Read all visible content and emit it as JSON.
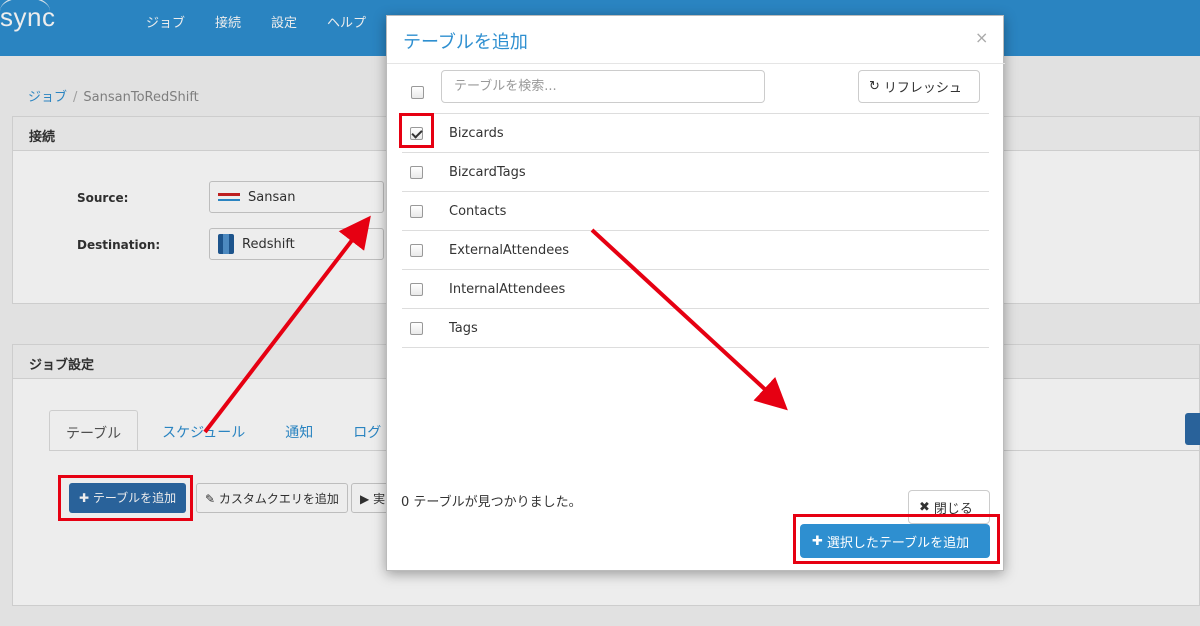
{
  "app": {
    "logo_text": "sync",
    "nav": [
      "ジョブ",
      "接続",
      "設定",
      "ヘルプ"
    ]
  },
  "breadcrumb": {
    "parent": "ジョブ",
    "separator": "/",
    "current": "SansanToRedShift"
  },
  "connection_panel": {
    "heading": "接続",
    "source_label": "Source:",
    "source_value": "Sansan",
    "destination_label": "Destination:",
    "destination_value": "Redshift"
  },
  "job_panel": {
    "heading": "ジョブ設定",
    "tabs": [
      "テーブル",
      "スケジュール",
      "通知",
      "ログ"
    ],
    "add_table_button": "テーブルを追加",
    "custom_query_button": "カスタムクエリを追加",
    "run_button": "実"
  },
  "modal": {
    "title": "テーブルを追加",
    "close_glyph": "×",
    "search_placeholder": "テーブルを検索...",
    "refresh_label": "リフレッシュ",
    "tables": [
      {
        "name": "Bizcards",
        "checked": true
      },
      {
        "name": "BizcardTags",
        "checked": false
      },
      {
        "name": "Contacts",
        "checked": false
      },
      {
        "name": "ExternalAttendees",
        "checked": false
      },
      {
        "name": "InternalAttendees",
        "checked": false
      },
      {
        "name": "Tags",
        "checked": false
      }
    ],
    "found_text": "0 テーブルが見つかりました。",
    "close_button": "閉じる",
    "add_selected_button": "選択したテーブルを追加"
  },
  "colors": {
    "brand_blue": "#2e8fd0",
    "dark_button_blue": "#2d6aa6",
    "annotation_red": "#e60012"
  }
}
